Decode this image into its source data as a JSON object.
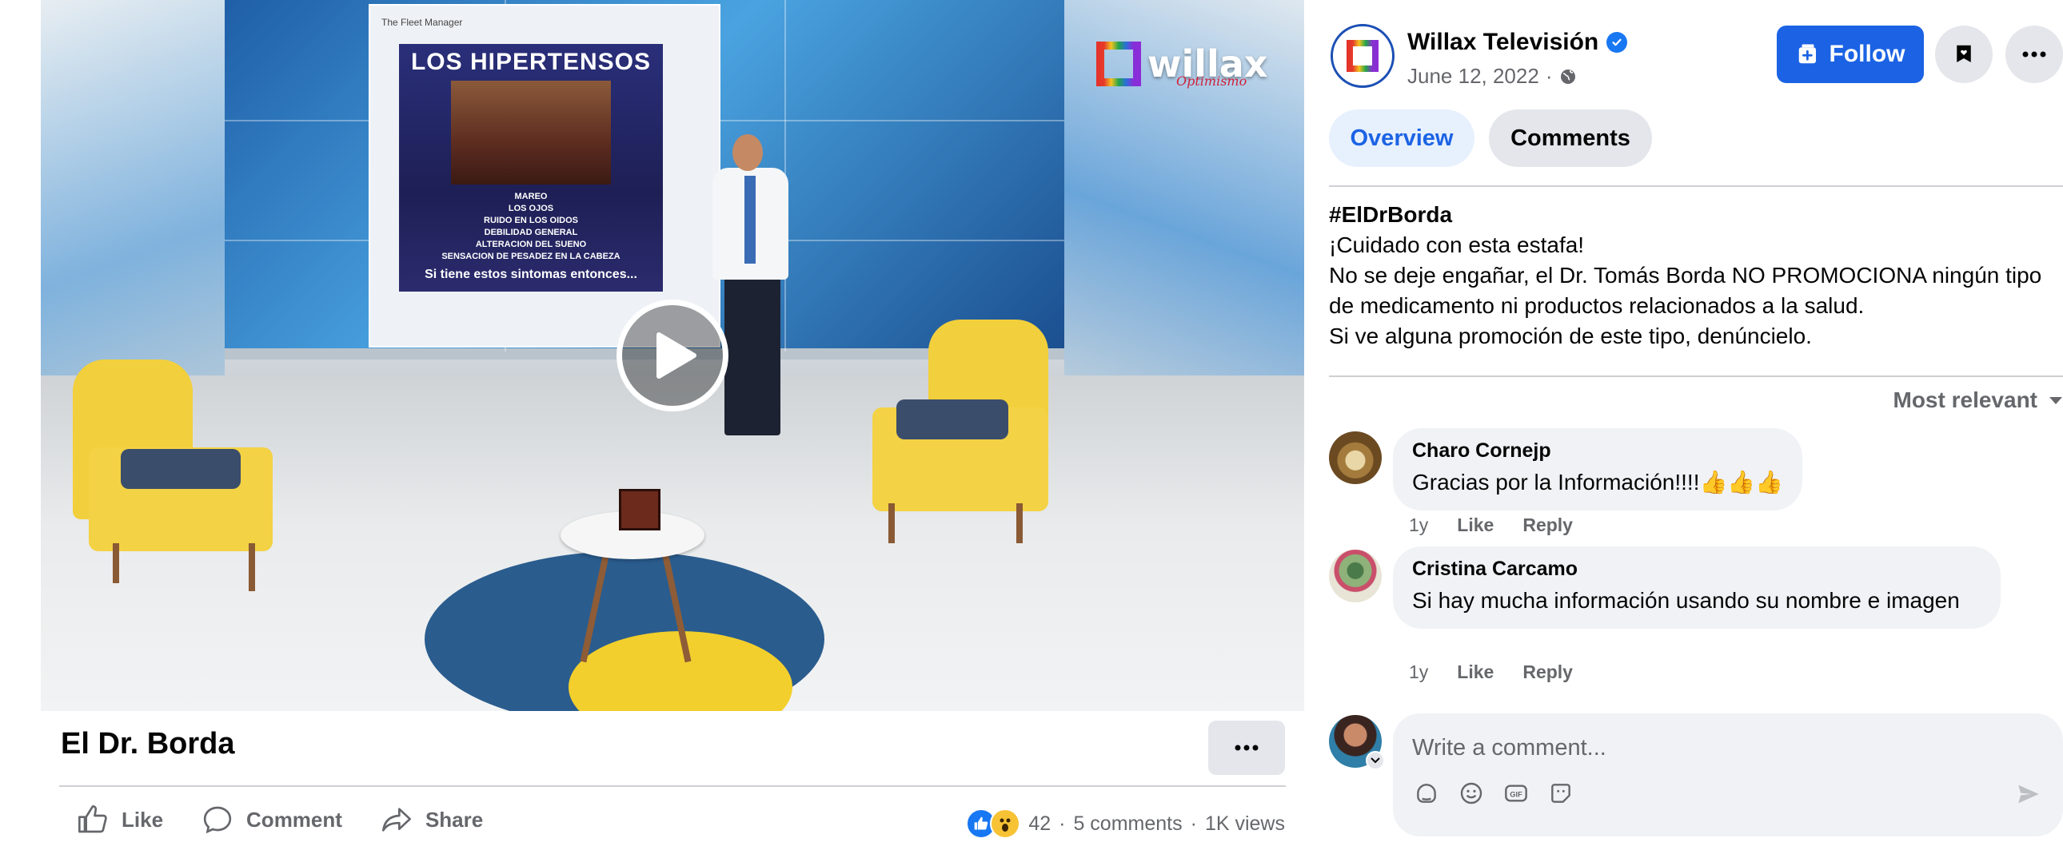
{
  "video": {
    "logo_text": "willax",
    "logo_sub": "Optimismo",
    "screen_post": {
      "page_label": "The Fleet Manager",
      "title": "LOS HIPERTENSOS",
      "symptoms": [
        "MAREO",
        "LOS OJOS",
        "RUIDO EN LOS OIDOS",
        "DEBILIDAD GENERAL",
        "ALTERACION DEL SUENO",
        "SENSACION DE PESADEZ EN LA CABEZA"
      ],
      "footer": "Si tiene estos sintomas entonces..."
    },
    "title": "El Dr. Borda"
  },
  "actions": {
    "like": "Like",
    "comment": "Comment",
    "share": "Share"
  },
  "stats": {
    "reactions": "42",
    "comments": "5 comments",
    "views": "1K views",
    "separator": "·"
  },
  "page": {
    "name": "Willax Televisión",
    "date": "June 12, 2022",
    "date_sep": "·",
    "follow": "Follow"
  },
  "tabs": {
    "overview": "Overview",
    "comments": "Comments"
  },
  "caption": {
    "hashtag": "#ElDrBorda",
    "lines": [
      "¡Cuidado con esta estafa!",
      "No se deje engañar, el Dr. Tomás Borda NO PROMOCIONA ningún tipo de medicamento ni productos relacionados a la salud.",
      "Si ve alguna promoción de este tipo, denúncielo."
    ]
  },
  "sort": "Most relevant",
  "comments": [
    {
      "author": "Charo Cornejp",
      "text": "Gracias por la Información!!!!👍👍👍",
      "time": "1y",
      "like": "Like",
      "reply": "Reply"
    },
    {
      "author": "Cristina Carcamo",
      "text": "Si hay mucha información usando su nombre e imagen",
      "time": "1y",
      "like": "Like",
      "reply": "Reply"
    }
  ],
  "composer": {
    "placeholder": "Write a comment...",
    "icons": [
      "sticker-icon",
      "emoji-icon",
      "gif-icon",
      "avatar-sticker-icon"
    ]
  },
  "colors": {
    "accent": "#1b63e4",
    "text": "#050505",
    "muted": "#65676b",
    "bubble": "#f0f2f5"
  }
}
